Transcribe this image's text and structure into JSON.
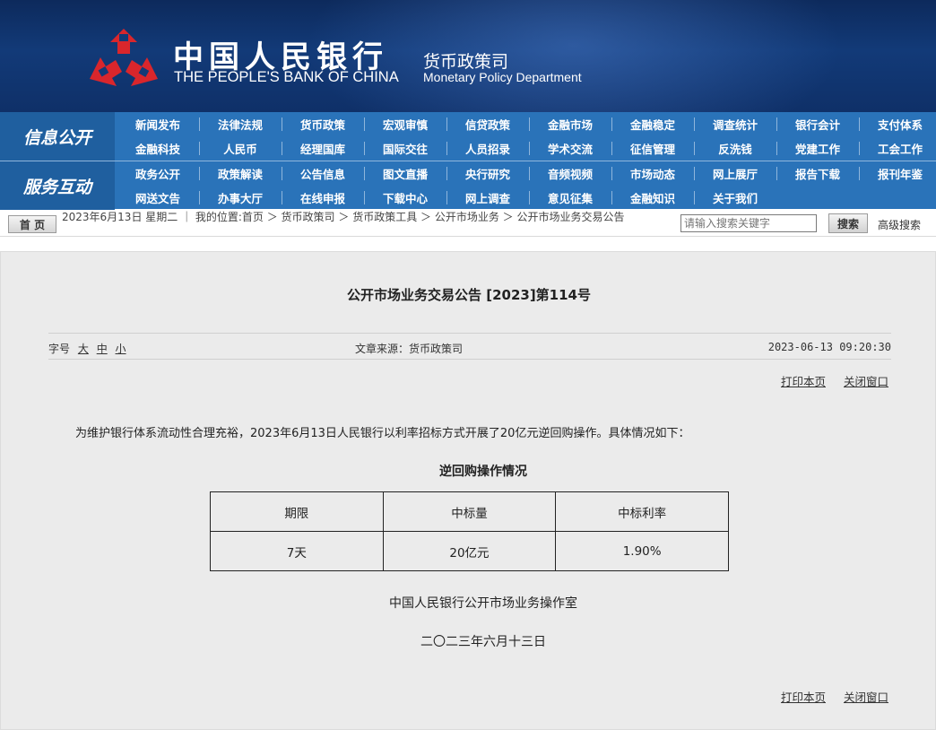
{
  "header": {
    "bank_name_cn": "中国人民银行",
    "bank_name_en": "THE PEOPLE'S BANK OF CHINA",
    "department_cn": "货币政策司",
    "department_en": "Monetary Policy Department",
    "logo_icon": "pboc-logo-icon",
    "logo_color": "#d9262c"
  },
  "nav": {
    "info_title": "信息公开",
    "info_row1": [
      "新闻发布",
      "法律法规",
      "货币政策",
      "宏观审慎",
      "信贷政策",
      "金融市场",
      "金融稳定",
      "调查统计",
      "银行会计",
      "支付体系"
    ],
    "info_row2": [
      "金融科技",
      "人民币",
      "经理国库",
      "国际交往",
      "人员招录",
      "学术交流",
      "征信管理",
      "反洗钱",
      "党建工作",
      "工会工作"
    ],
    "service_title": "服务互动",
    "service_row1": [
      "政务公开",
      "政策解读",
      "公告信息",
      "图文直播",
      "央行研究",
      "音频视频",
      "市场动态",
      "网上展厅",
      "报告下载",
      "报刊年鉴"
    ],
    "service_row2": [
      "网送文告",
      "办事大厅",
      "在线申报",
      "下载中心",
      "网上调查",
      "意见征集",
      "金融知识",
      "关于我们"
    ]
  },
  "crumb": {
    "home": "首 页",
    "text": "2023年6月13日 星期二 ｜ 我的位置:首页 ＞ 货币政策司 ＞ 货币政策工具 ＞ 公开市场业务 ＞ 公开市场业务交易公告",
    "search_placeholder": "请输入搜索关键字",
    "search_button": "搜索",
    "advanced_search": "高级搜索"
  },
  "article": {
    "title": "公开市场业务交易公告 [2023]第114号",
    "font_size_label": "字号",
    "size_large": "大",
    "size_medium": "中",
    "size_small": "小",
    "source": "文章来源：货币政策司",
    "datetime": "2023-06-13 09:20:30",
    "print": "打印本页",
    "close": "关闭窗口",
    "paragraph": "为维护银行体系流动性合理充裕，2023年6月13日人民银行以利率招标方式开展了20亿元逆回购操作。具体情况如下：",
    "table_title": "逆回购操作情况",
    "table_headers": [
      "期限",
      "中标量",
      "中标利率"
    ],
    "table_row": [
      "7天",
      "20亿元",
      "1.90%"
    ],
    "signer": "中国人民银行公开市场业务操作室",
    "sign_date": "二〇二三年六月十三日"
  }
}
